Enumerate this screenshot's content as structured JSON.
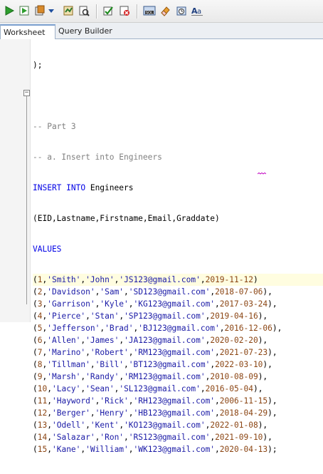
{
  "tabs": [
    {
      "label": "Worksheet"
    },
    {
      "label": "Query Builder"
    }
  ],
  "toolbar_icons": [
    "run-statement-icon",
    "run-script-icon",
    "commit-icon",
    "dropdown-arrow-icon",
    "autotrace-icon",
    "explain-plan-icon",
    "commit-transaction-icon",
    "rollback-icon",
    "sql-tuning-icon",
    "clear-icon",
    "history-icon",
    "format-icon"
  ],
  "editor": {
    "pre_lines": [
      ");",
      "",
      "-- Part 3",
      "-- a. Insert into Engineers"
    ],
    "insert_line": {
      "keyword": "INSERT INTO",
      "table": " Engineers"
    },
    "columns_line": "(EID,Lastname,Firstname,Email,Graddate)",
    "values_keyword": "VALUES",
    "rows": [
      {
        "id": "1",
        "last": "'Smith'",
        "first": "'John'",
        "email": "'JS123@gmail.com'",
        "date": "2019-11-12",
        "end": ")"
      },
      {
        "id": "2",
        "last": "'Davidson'",
        "first": "'Sam'",
        "email": "'SD123@gmail.com'",
        "date": "2018-07-06",
        "end": "),"
      },
      {
        "id": "3",
        "last": "'Garrison'",
        "first": "'Kyle'",
        "email": "'KG123@gmail.com'",
        "date": "2017-03-24",
        "end": "),"
      },
      {
        "id": "4",
        "last": "'Pierce'",
        "first": "'Stan'",
        "email": "'SP123@gmail.com'",
        "date": "2019-04-16",
        "end": "),"
      },
      {
        "id": "5",
        "last": "'Jefferson'",
        "first": "'Brad'",
        "email": "'BJ123@gmail.com'",
        "date": "2016-12-06",
        "end": "),"
      },
      {
        "id": "6",
        "last": "'Allen'",
        "first": "'James'",
        "email": "'JA123@gmail.com'",
        "date": "2020-02-20",
        "end": "),"
      },
      {
        "id": "7",
        "last": "'Marino'",
        "first": "'Robert'",
        "email": "'RM123@gmail.com'",
        "date": "2021-07-23",
        "end": "),"
      },
      {
        "id": "8",
        "last": "'Tillman'",
        "first": "'Bill'",
        "email": "'BT123@gmail.com'",
        "date": "2022-03-10",
        "end": "),"
      },
      {
        "id": "9",
        "last": "'Marsh'",
        "first": "'Randy'",
        "email": "'RM123@gmail.com'",
        "date": "2010-08-09",
        "end": "),"
      },
      {
        "id": "10",
        "last": "'Lacy'",
        "first": "'Sean'",
        "email": "'SL123@gmail.com'",
        "date": "2016-05-04",
        "end": "),"
      },
      {
        "id": "11",
        "last": "'Hayword'",
        "first": "'Rick'",
        "email": "'RH123@gmail.com'",
        "date": "2006-11-15",
        "end": "),"
      },
      {
        "id": "12",
        "last": "'Berger'",
        "first": "'Henry'",
        "email": "'HB123@gmail.com'",
        "date": "2018-04-29",
        "end": "),"
      },
      {
        "id": "13",
        "last": "'Odell'",
        "first": "'Kent'",
        "email": "'KO123@gmail.com'",
        "date": "2022-01-08",
        "end": "),"
      },
      {
        "id": "14",
        "last": "'Salazar'",
        "first": "'Ron'",
        "email": "'RS123@gmail.com'",
        "date": "2021-09-10",
        "end": "),"
      },
      {
        "id": "15",
        "last": "'Kane'",
        "first": "'William'",
        "email": "'WK123@gmail.com'",
        "date": "2020-04-13",
        "end": ");"
      }
    ]
  },
  "colors": {
    "keyword": "#0000e6",
    "comment": "#808080",
    "string": "#1a1aa6",
    "number": "#8b4513",
    "squiggle": "#c000c0"
  }
}
